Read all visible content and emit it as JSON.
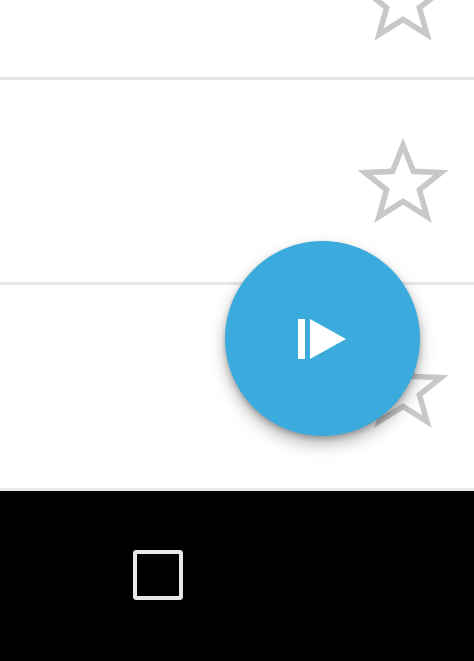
{
  "list": {
    "items": [
      {
        "favorite_icon": "star-outline-icon",
        "starred": false
      },
      {
        "favorite_icon": "star-outline-icon",
        "starred": false
      },
      {
        "favorite_icon": "star-outline-icon",
        "starred": false
      }
    ]
  },
  "fab": {
    "icon": "skip-play-icon",
    "color": "#3aabdc"
  },
  "navigation_bar": {
    "recents_icon": "recents-square-icon",
    "background": "#000000"
  },
  "colors": {
    "star_outline": "#c8c8c8",
    "divider": "#e6e6e6"
  }
}
